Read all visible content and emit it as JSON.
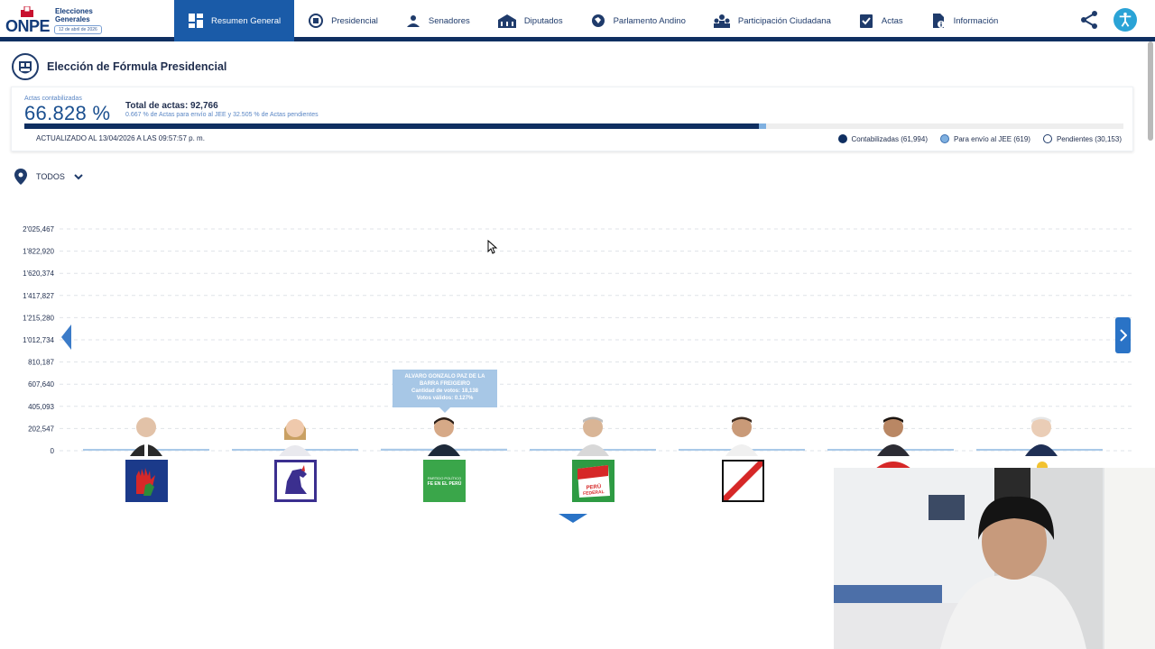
{
  "header": {
    "logo_text": "ONPE",
    "logo_title_line1": "Elecciones",
    "logo_title_line2": "Generales",
    "logo_date": "12 de abril de 2026",
    "nav": [
      {
        "label": "Resumen General",
        "icon": "dashboard-icon",
        "active": true
      },
      {
        "label": "Presidencial",
        "icon": "presidential-seal-icon",
        "active": false
      },
      {
        "label": "Senadores",
        "icon": "senators-icon",
        "active": false
      },
      {
        "label": "Diputados",
        "icon": "congress-building-icon",
        "active": false
      },
      {
        "label": "Parlamento Andino",
        "icon": "globe-icon",
        "active": false
      },
      {
        "label": "Participación Ciudadana",
        "icon": "people-icon",
        "active": false
      },
      {
        "label": "Actas",
        "icon": "clipboard-check-icon",
        "active": false
      },
      {
        "label": "Información",
        "icon": "info-document-icon",
        "active": false
      }
    ],
    "accent": "#1a5ba8",
    "navy": "#0f2f61"
  },
  "page": {
    "title": "Elección de Fórmula Presidencial"
  },
  "summary": {
    "actas_label": "Actas contabilizadas",
    "actas_pct": "66.828 %",
    "total_actas": "Total de actas: 92,766",
    "sub": "0.667 % de Actas para envío al JEE y 32.505 % de Actas pendientes",
    "progress_counted_pct": 66.828,
    "progress_jee_pct": 0.667,
    "updated": "ACTUALIZADO AL 13/04/2026 A LAS 09:57:57 p. m.",
    "legend": [
      {
        "label": "Contabilizadas (61,994)",
        "color": "#0f2f61"
      },
      {
        "label": "Para envío al JEE (619)",
        "color": "#7fb0e0"
      },
      {
        "label": "Pendientes (30,153)",
        "color": "#ffffff"
      }
    ]
  },
  "filter": {
    "label": "TODOS"
  },
  "tooltip": {
    "line1": "ALVARO GONZALO PAZ DE LA",
    "line2": "BARRA FREIGEIRO",
    "line3": "Cantidad de votos: 18,138",
    "line4": "Votos válidos: 0.127%"
  },
  "chart_data": {
    "type": "bar",
    "y_ticks": [
      "2'025,467",
      "1'822,920",
      "1'620,374",
      "1'417,827",
      "1'215,280",
      "1'012,734",
      "810,187",
      "607,640",
      "405,093",
      "202,547",
      "0"
    ],
    "ylim": [
      0,
      2025467
    ],
    "grid": true,
    "series": [
      {
        "values": [
          9000,
          9000,
          18138,
          5000,
          2000,
          1500,
          1200
        ]
      }
    ]
  }
}
